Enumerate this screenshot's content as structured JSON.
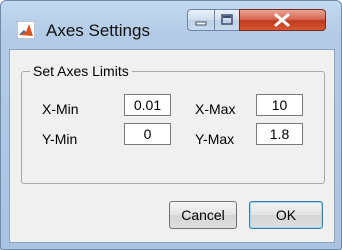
{
  "window": {
    "title": "Axes Settings",
    "icon": "matlab-icon",
    "caption_buttons": [
      "minimize-icon",
      "maximize-icon",
      "close-icon"
    ]
  },
  "group": {
    "legend": "Set Axes Limits"
  },
  "fields": {
    "xmin": {
      "label": "X-Min",
      "value": "0.01"
    },
    "xmax": {
      "label": "X-Max",
      "value": "10"
    },
    "ymin": {
      "label": "Y-Min",
      "value": "0"
    },
    "ymax": {
      "label": "Y-Max",
      "value": "1.8"
    }
  },
  "buttons": {
    "cancel": "Cancel",
    "ok": "OK"
  },
  "colors": {
    "title_bar": "#b9d1ea",
    "close_button": "#c9462c",
    "content_background": "#f0f0f0"
  }
}
